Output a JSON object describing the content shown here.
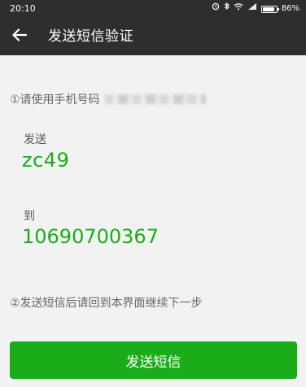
{
  "status_bar": {
    "time": "20:10",
    "battery_text": "86%",
    "battery_level": 0.86
  },
  "header": {
    "title": "发送短信验证",
    "back_icon": "arrow-left-icon"
  },
  "main": {
    "step1_text": "①请使用手机号码",
    "send_label": "发送",
    "code": "zc49",
    "to_label": "到",
    "number": "10690700367",
    "step2_text": "②发送短信后请回到本界面继续下一步",
    "button_label": "发送短信"
  },
  "colors": {
    "accent": "#1aad19",
    "header_bg": "#2e2e2e",
    "page_bg": "#f2f2f2"
  }
}
